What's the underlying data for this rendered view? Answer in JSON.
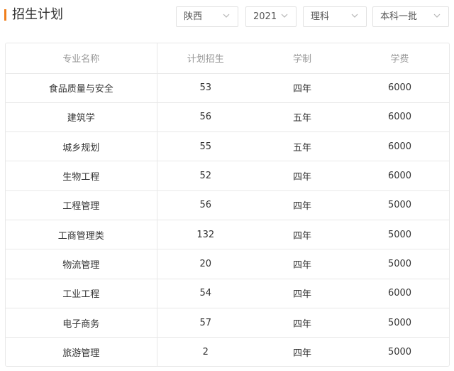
{
  "header": {
    "title": "招生计划",
    "accent_color": "#f07e1b"
  },
  "filters": {
    "province": "陕西",
    "year": "2021",
    "subject": "理科",
    "batch": "本科一批",
    "chevron_icon": "chevron-down-icon"
  },
  "table": {
    "columns": [
      "专业名称",
      "计划招生",
      "学制",
      "学费"
    ],
    "rows": [
      [
        "食品质量与安全",
        "53",
        "四年",
        "6000"
      ],
      [
        "建筑学",
        "56",
        "五年",
        "6000"
      ],
      [
        "城乡规划",
        "55",
        "五年",
        "6000"
      ],
      [
        "生物工程",
        "52",
        "四年",
        "6000"
      ],
      [
        "工程管理",
        "56",
        "四年",
        "5000"
      ],
      [
        "工商管理类",
        "132",
        "四年",
        "5000"
      ],
      [
        "物流管理",
        "20",
        "四年",
        "5000"
      ],
      [
        "工业工程",
        "54",
        "四年",
        "6000"
      ],
      [
        "电子商务",
        "57",
        "四年",
        "5000"
      ],
      [
        "旅游管理",
        "2",
        "四年",
        "5000"
      ]
    ]
  }
}
